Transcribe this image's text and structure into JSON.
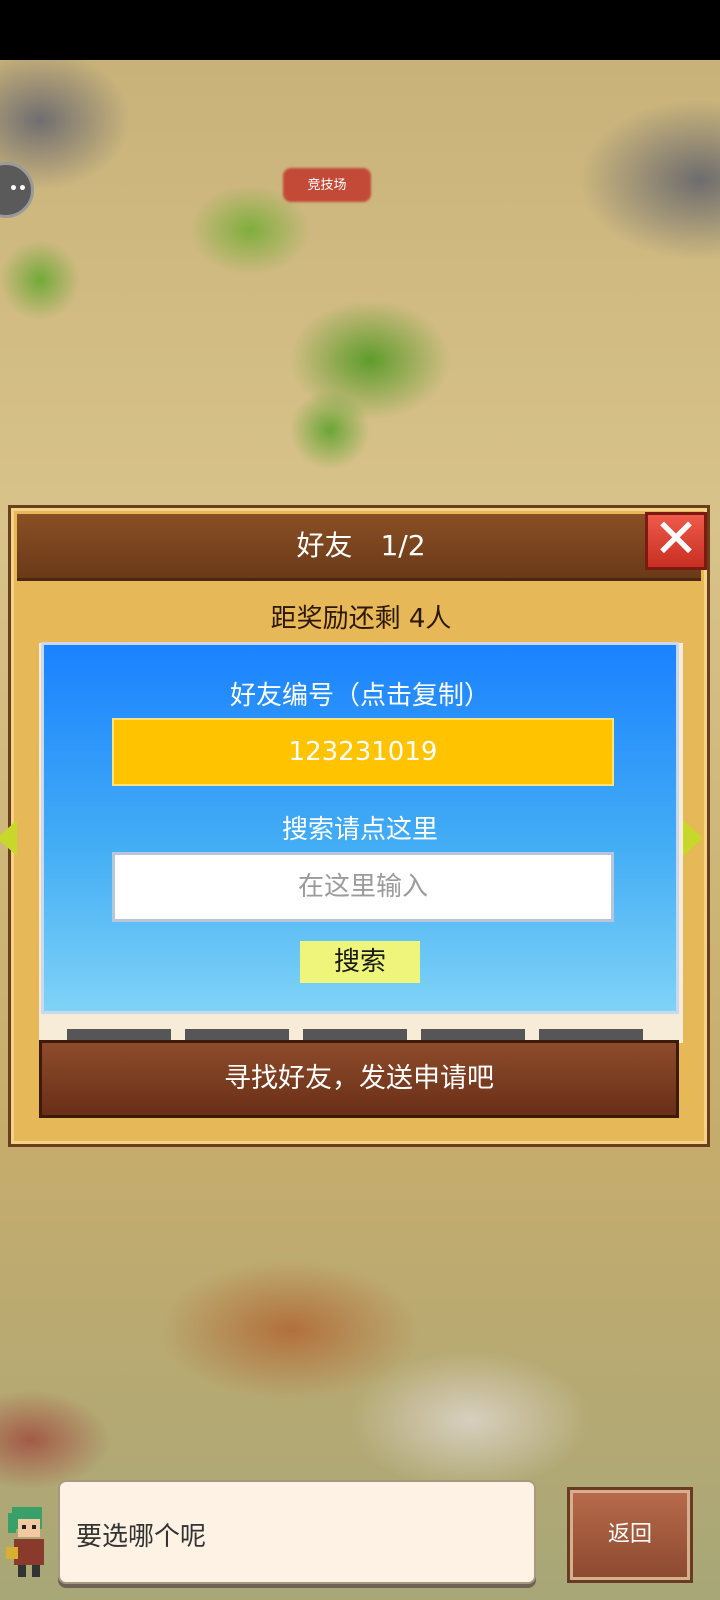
{
  "map": {
    "arena_label": "竞技场"
  },
  "friends_panel": {
    "title": "好友　1/2",
    "close_label": "✕",
    "reward_text": "距奖励还剩 4人",
    "send_button_label": "寻找好友，发送申请吧"
  },
  "friend_dialog": {
    "id_label": "好友编号（点击复制）",
    "id_value": "123231019",
    "search_label": "搜索请点这里",
    "search_placeholder": "在这里输入",
    "search_button_label": "搜索"
  },
  "bottom_bar": {
    "speech_text": "要选哪个呢",
    "back_button_label": "返回"
  },
  "colors": {
    "panel": "#e6b857",
    "panel_border": "#6b3e1c",
    "dialog_top": "#1a82ff",
    "dialog_bottom": "#7fd3f7",
    "id_box": "#ffc300",
    "search_button": "#eef57a",
    "close_button": "#e04a3a"
  }
}
